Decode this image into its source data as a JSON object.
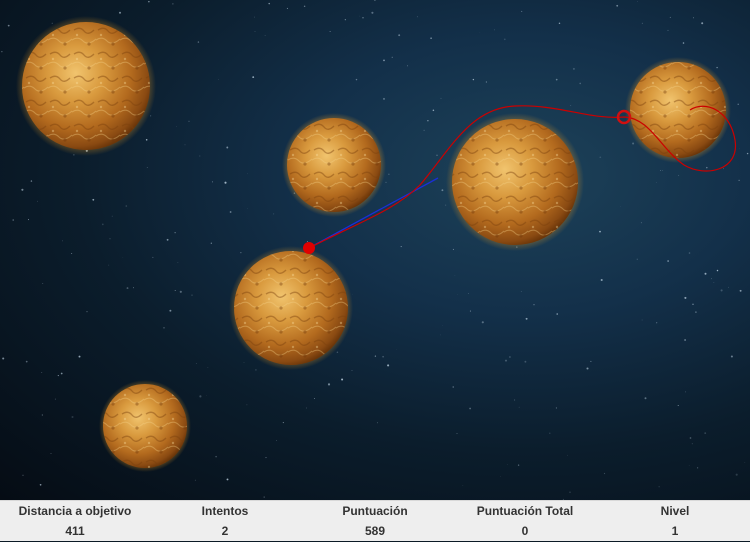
{
  "game": {
    "planet_color": "#d08a30",
    "trajectory_color": "#cc0000",
    "aim_line_color": "#1a2fd6",
    "ball_color": "#e00000",
    "target_color": "#d01010"
  },
  "hud": {
    "stats": [
      {
        "label": "Distancia a objetivo",
        "value": "411"
      },
      {
        "label": "Intentos",
        "value": "2"
      },
      {
        "label": "Puntuación",
        "value": "589"
      },
      {
        "label": "Puntuación Total",
        "value": "0"
      },
      {
        "label": "Nivel",
        "value": "1"
      }
    ]
  }
}
